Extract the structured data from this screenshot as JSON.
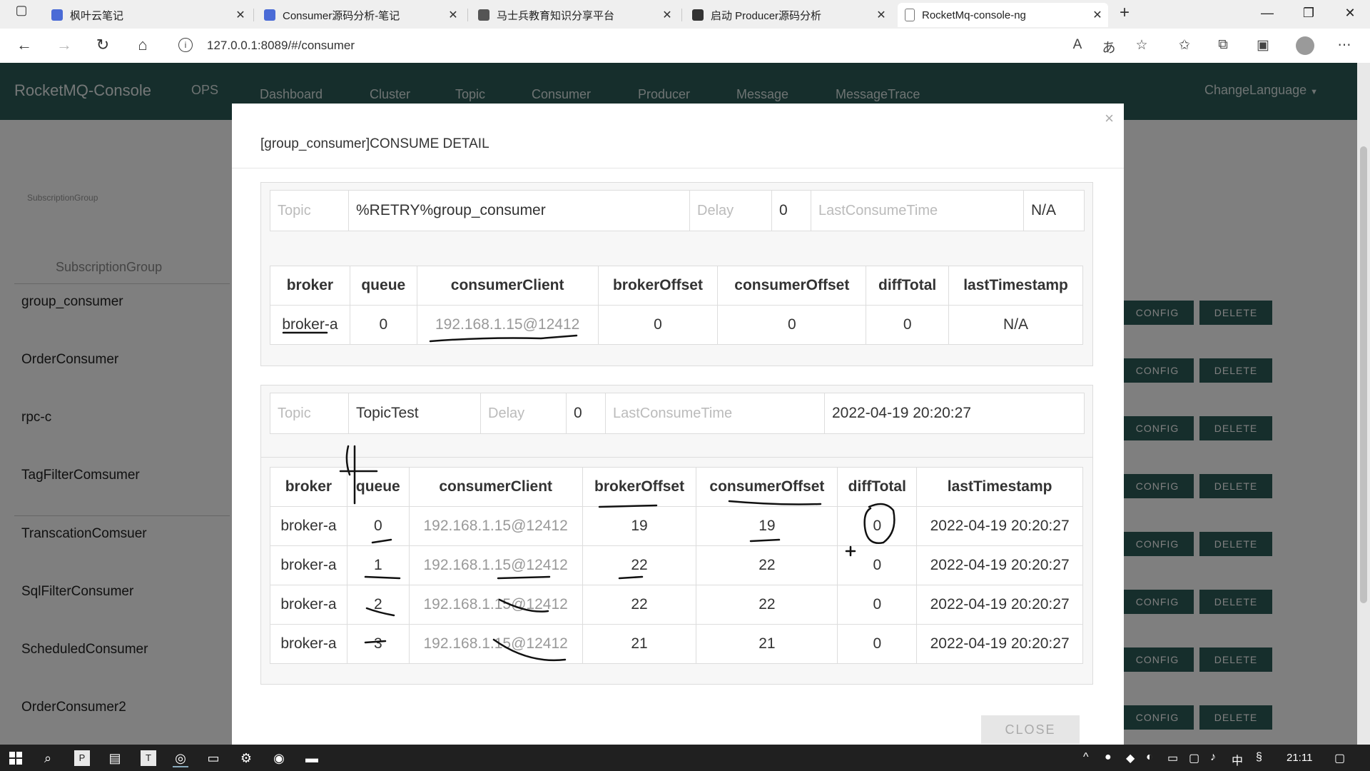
{
  "browser": {
    "tabs": [
      {
        "label": "枫叶云笔记",
        "icon_color": "#4a6bd6"
      },
      {
        "label": "Consumer源码分析-笔记",
        "icon_color": "#4a6bd6"
      },
      {
        "label": "马士兵教育知识分享平台",
        "icon_color": "#555555"
      },
      {
        "label": "启动 Producer源码分析",
        "icon_color": "#333333"
      },
      {
        "label": "RocketMq-console-ng",
        "icon_color": "#777777"
      }
    ],
    "url": "127.0.0.1:8089/#/consumer"
  },
  "app": {
    "brand": "RocketMQ-Console",
    "nav": [
      "OPS",
      "Dashboard",
      "Cluster",
      "Topic",
      "Consumer",
      "Producer",
      "Message",
      "MessageTrace"
    ],
    "change_language": "ChangeLanguage",
    "nav_color": "#2d5c59"
  },
  "background": {
    "header_small": "SubscriptionGroup",
    "header": "SubscriptionGroup",
    "groups": [
      "group_consumer",
      "OrderConsumer",
      "rpc-c",
      "TagFilterComsumer",
      "TranscationComsuer",
      "SqlFilterConsumer",
      "ScheduledConsumer",
      "OrderConsumer2"
    ],
    "config_label": "CONFIG",
    "delete_label": "DELETE"
  },
  "modal": {
    "title": "[group_consumer]CONSUME DETAIL",
    "close_x": "×",
    "close_button": "CLOSE",
    "labels": {
      "topic": "Topic",
      "delay": "Delay",
      "last_consume_time": "LastConsumeTime"
    },
    "columns": [
      "broker",
      "queue",
      "consumerClient",
      "brokerOffset",
      "consumerOffset",
      "diffTotal",
      "lastTimestamp"
    ],
    "sections": [
      {
        "topic": "%RETRY%group_consumer",
        "delay": "0",
        "last_consume_time": "N/A",
        "rows": [
          [
            "broker-a",
            "0",
            "192.168.1.15@12412",
            "0",
            "0",
            "0",
            "N/A"
          ]
        ]
      },
      {
        "topic": "TopicTest",
        "delay": "0",
        "last_consume_time": "2022-04-19 20:20:27",
        "rows": [
          [
            "broker-a",
            "0",
            "192.168.1.15@12412",
            "19",
            "19",
            "0",
            "2022-04-19 20:20:27"
          ],
          [
            "broker-a",
            "1",
            "192.168.1.15@12412",
            "22",
            "22",
            "0",
            "2022-04-19 20:20:27"
          ],
          [
            "broker-a",
            "2",
            "192.168.1.15@12412",
            "22",
            "22",
            "0",
            "2022-04-19 20:20:27"
          ],
          [
            "broker-a",
            "3",
            "192.168.1.15@12412",
            "21",
            "21",
            "0",
            "2022-04-19 20:20:27"
          ]
        ]
      }
    ]
  },
  "taskbar": {
    "time": "21:11",
    "ime": "中"
  }
}
